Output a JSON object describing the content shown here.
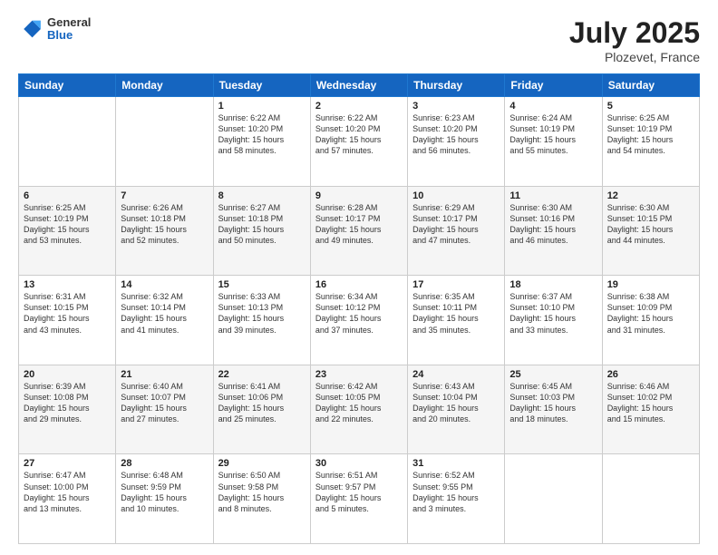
{
  "header": {
    "logo": {
      "general": "General",
      "blue": "Blue"
    },
    "month": "July 2025",
    "location": "Plozevet, France"
  },
  "days_of_week": [
    "Sunday",
    "Monday",
    "Tuesday",
    "Wednesday",
    "Thursday",
    "Friday",
    "Saturday"
  ],
  "weeks": [
    [
      {
        "day": "",
        "info": ""
      },
      {
        "day": "",
        "info": ""
      },
      {
        "day": "1",
        "info": "Sunrise: 6:22 AM\nSunset: 10:20 PM\nDaylight: 15 hours\nand 58 minutes."
      },
      {
        "day": "2",
        "info": "Sunrise: 6:22 AM\nSunset: 10:20 PM\nDaylight: 15 hours\nand 57 minutes."
      },
      {
        "day": "3",
        "info": "Sunrise: 6:23 AM\nSunset: 10:20 PM\nDaylight: 15 hours\nand 56 minutes."
      },
      {
        "day": "4",
        "info": "Sunrise: 6:24 AM\nSunset: 10:19 PM\nDaylight: 15 hours\nand 55 minutes."
      },
      {
        "day": "5",
        "info": "Sunrise: 6:25 AM\nSunset: 10:19 PM\nDaylight: 15 hours\nand 54 minutes."
      }
    ],
    [
      {
        "day": "6",
        "info": "Sunrise: 6:25 AM\nSunset: 10:19 PM\nDaylight: 15 hours\nand 53 minutes."
      },
      {
        "day": "7",
        "info": "Sunrise: 6:26 AM\nSunset: 10:18 PM\nDaylight: 15 hours\nand 52 minutes."
      },
      {
        "day": "8",
        "info": "Sunrise: 6:27 AM\nSunset: 10:18 PM\nDaylight: 15 hours\nand 50 minutes."
      },
      {
        "day": "9",
        "info": "Sunrise: 6:28 AM\nSunset: 10:17 PM\nDaylight: 15 hours\nand 49 minutes."
      },
      {
        "day": "10",
        "info": "Sunrise: 6:29 AM\nSunset: 10:17 PM\nDaylight: 15 hours\nand 47 minutes."
      },
      {
        "day": "11",
        "info": "Sunrise: 6:30 AM\nSunset: 10:16 PM\nDaylight: 15 hours\nand 46 minutes."
      },
      {
        "day": "12",
        "info": "Sunrise: 6:30 AM\nSunset: 10:15 PM\nDaylight: 15 hours\nand 44 minutes."
      }
    ],
    [
      {
        "day": "13",
        "info": "Sunrise: 6:31 AM\nSunset: 10:15 PM\nDaylight: 15 hours\nand 43 minutes."
      },
      {
        "day": "14",
        "info": "Sunrise: 6:32 AM\nSunset: 10:14 PM\nDaylight: 15 hours\nand 41 minutes."
      },
      {
        "day": "15",
        "info": "Sunrise: 6:33 AM\nSunset: 10:13 PM\nDaylight: 15 hours\nand 39 minutes."
      },
      {
        "day": "16",
        "info": "Sunrise: 6:34 AM\nSunset: 10:12 PM\nDaylight: 15 hours\nand 37 minutes."
      },
      {
        "day": "17",
        "info": "Sunrise: 6:35 AM\nSunset: 10:11 PM\nDaylight: 15 hours\nand 35 minutes."
      },
      {
        "day": "18",
        "info": "Sunrise: 6:37 AM\nSunset: 10:10 PM\nDaylight: 15 hours\nand 33 minutes."
      },
      {
        "day": "19",
        "info": "Sunrise: 6:38 AM\nSunset: 10:09 PM\nDaylight: 15 hours\nand 31 minutes."
      }
    ],
    [
      {
        "day": "20",
        "info": "Sunrise: 6:39 AM\nSunset: 10:08 PM\nDaylight: 15 hours\nand 29 minutes."
      },
      {
        "day": "21",
        "info": "Sunrise: 6:40 AM\nSunset: 10:07 PM\nDaylight: 15 hours\nand 27 minutes."
      },
      {
        "day": "22",
        "info": "Sunrise: 6:41 AM\nSunset: 10:06 PM\nDaylight: 15 hours\nand 25 minutes."
      },
      {
        "day": "23",
        "info": "Sunrise: 6:42 AM\nSunset: 10:05 PM\nDaylight: 15 hours\nand 22 minutes."
      },
      {
        "day": "24",
        "info": "Sunrise: 6:43 AM\nSunset: 10:04 PM\nDaylight: 15 hours\nand 20 minutes."
      },
      {
        "day": "25",
        "info": "Sunrise: 6:45 AM\nSunset: 10:03 PM\nDaylight: 15 hours\nand 18 minutes."
      },
      {
        "day": "26",
        "info": "Sunrise: 6:46 AM\nSunset: 10:02 PM\nDaylight: 15 hours\nand 15 minutes."
      }
    ],
    [
      {
        "day": "27",
        "info": "Sunrise: 6:47 AM\nSunset: 10:00 PM\nDaylight: 15 hours\nand 13 minutes."
      },
      {
        "day": "28",
        "info": "Sunrise: 6:48 AM\nSunset: 9:59 PM\nDaylight: 15 hours\nand 10 minutes."
      },
      {
        "day": "29",
        "info": "Sunrise: 6:50 AM\nSunset: 9:58 PM\nDaylight: 15 hours\nand 8 minutes."
      },
      {
        "day": "30",
        "info": "Sunrise: 6:51 AM\nSunset: 9:57 PM\nDaylight: 15 hours\nand 5 minutes."
      },
      {
        "day": "31",
        "info": "Sunrise: 6:52 AM\nSunset: 9:55 PM\nDaylight: 15 hours\nand 3 minutes."
      },
      {
        "day": "",
        "info": ""
      },
      {
        "day": "",
        "info": ""
      }
    ]
  ]
}
